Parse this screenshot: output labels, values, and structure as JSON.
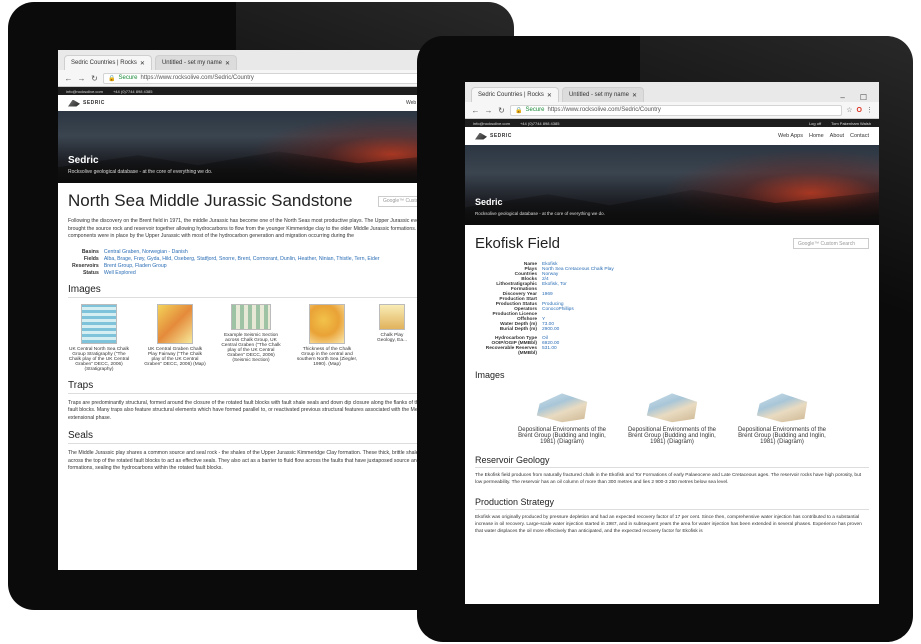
{
  "browser": {
    "tab1": "Sedric Countries | Rocks",
    "tab2": "Untitled - set my name",
    "url_secure": "Secure",
    "url": "https://www.rocksolive.com/Sedric/Country",
    "url2": "https://www.rocksolive.com/Sedric/Country"
  },
  "topbar": {
    "email": "info@rocksolive.com",
    "phone": "+44 (0)7744 898 4385",
    "login": "Log off",
    "user": "Tom Pakenham Walsh"
  },
  "site": {
    "logo": "SEDRIC",
    "menu": [
      "Web Apps",
      "Home",
      "About",
      "Contact"
    ],
    "hero_title": "Sedric",
    "hero_sub": "Rocksolive geological database - at the core of everything we do.",
    "search_placeholder": "Google™ Custom Search"
  },
  "left": {
    "title": "North Sea Middle Jurassic Sandstone",
    "intro": "Following the discovery on the Brent field in 1971, the middle Jurassic has become one of the North Seas most productive plays. The Upper Jurassic event has brought the source rock and reservoir together allowing hydrocarbons to flow from the younger Kimmeridge clay to the older Middle Jurassic formations. The play components were in place by the Upper Jurassic with most of the hydrocarbon generation and migration occurring during the",
    "facts": [
      {
        "k": "Basins",
        "v": "Central Graben, Norwegian - Danish"
      },
      {
        "k": "Fields",
        "v": "Alba, Brage, Frøy, Gyda, Hild, Oseberg, Statfjord, Snorre, Brent, Cormorant, Dunlin, Heather, Ninian, Thistle, Tern, Eider"
      },
      {
        "k": "Reservoirs",
        "v": "Brent Group, Fladen Group"
      },
      {
        "k": "Status",
        "v": "Well Explored"
      }
    ],
    "images_heading": "Images",
    "images": [
      "UK Central North Sea Chalk Group Stratigraphy (\"The Chalk play of the UK Central Graben\" DECC, 2006) (Stratigraphy)",
      "UK Central Graben Chalk Play Fairway (\"The Chalk play of the UK Central Graben\" DECC, 2006) (Map)",
      "Example Seismic Section across Chalk Group, UK Central Graben (\"The Chalk play of the UK Central Graben\" DECC, 2006) (Seismic Section)",
      "Thickness of the Chalk Group in the central and southern North Sea (Ziegler, 1990). (Map)",
      "Chalk Play Geology, Ea..."
    ],
    "traps_heading": "Traps",
    "traps": "Traps are predominantly structural, formed around the closure of the rotated fault blocks with fault shale seals and down dip closure along the flanks of the rotated fault blocks. Many traps also feature structural elements which have formed parallel to, or reactivated previous structural features associated with the Mesozoic extensional phase.",
    "seals_heading": "Seals",
    "seals": "The Middle Jurassic play shares a common source and seal rock - the shales of the Upper Jurassic Kimmeridge Clay formation. These thick, brittle shales drape across the top of the rotated fault blocks to act as effective seals. They also act as a barrier to fluid flow across the faults that have juxtaposed source and reservoir formations, sealing the hydrocarbons within the rotated fault blocks."
  },
  "right": {
    "title": "Ekofisk Field",
    "facts": [
      {
        "k": "Name",
        "v": "Ekofisk"
      },
      {
        "k": "Plays",
        "v": "North Sea Cretaceous Chalk Play"
      },
      {
        "k": "Countries",
        "v": "Norway"
      },
      {
        "k": "Blocks",
        "v": "2/4"
      },
      {
        "k": "Lithostratigraphic Formations",
        "v": "Ekofisk, Tor"
      },
      {
        "k": "Discovery Year",
        "v": "1969"
      },
      {
        "k": "Production Start",
        "v": ""
      },
      {
        "k": "Production Status",
        "v": "Producing"
      },
      {
        "k": "Operators",
        "v": "ConocoPhillips"
      },
      {
        "k": "Production Licence",
        "v": ""
      },
      {
        "k": "Offshore",
        "v": "Y"
      },
      {
        "k": "Water Depth (m)",
        "v": "73.00"
      },
      {
        "k": "Burial Depth (m)",
        "v": "2900.00"
      },
      {
        "k": "Hydrocarbon Type",
        "v": "Oil"
      },
      {
        "k": "OOIP/OGIP (MMBbl)",
        "v": "6920.00"
      },
      {
        "k": "Recoverable Reserves (MMBbl)",
        "v": "531.00"
      }
    ],
    "images_heading": "Images",
    "images": [
      "Depositional Environments of the Brent Group (Budding and Inglin, 1981) (Diagram)",
      "Depositional Environments of the Brent Group (Budding and Inglin, 1981) (Diagram)",
      "Depositional Environments of the Brent Group (Budding and Inglin, 1981) (Diagram)"
    ],
    "reservoir_heading": "Reservoir Geology",
    "reservoir": "The Ekofisk field produces from naturally fractured chalk in the Ekofisk and Tor Formations of early Palaeocene and Late Cretaceous ages. The reservoir rocks have high porosity, but low permeability. The reservoir has an oil column of more than 300 metres and lies 2 900-3 250 metres below sea level.",
    "production_heading": "Production Strategy",
    "production": "Ekofisk was originally produced by pressure depletion and had an expected recovery factor of 17 per cent. Since then, comprehensive water injection has contributed to a substantial increase in oil recovery. Large-scale water injection started in 1987, and in subsequent years the area for water injection has been extended in several phases. Experience has proven that water displaces the oil more effectively than anticipated, and the expected recovery factor for Ekofisk is"
  }
}
